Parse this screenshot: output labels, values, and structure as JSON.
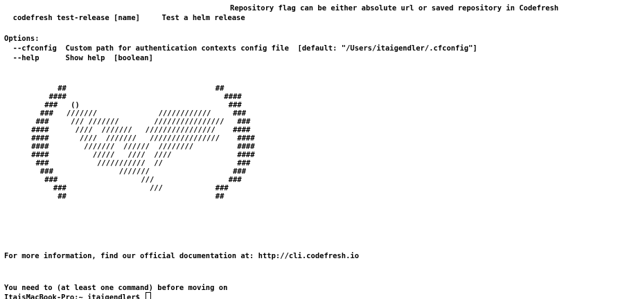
{
  "terminal": {
    "top_line": "Repository flag can be either absolute url or saved repository in Codefresh",
    "command_line": "  codefresh test-release [name]     Test a helm release",
    "options_header": "Options:",
    "option_cfconfig": "  --cfconfig  Custom path for authentication contexts config file  [default: \"/Users/itaigendler/.cfconfig\"]",
    "option_help": "  --help      Show help  [boolean]",
    "logo_ascii": "          ##                                  ##\n        ####                                    ####\n       ###   ()                                  ###\n      ###   ///////              ////////////     ###\n     ###     /// ///////        ////////////////   ###\n    ####      ////  ///////   ////////////////    ####\n    ####       ////  ///////   ////////////////    ####\n    ####        ///////  //////  ////////          ####\n    ####          /////   ////  ////               ####\n     ###           ///////////  //                 ###\n      ###               ///////                   ###\n       ###                   ///                 ###\n         ###                   ///            ###\n          ##                                  ##",
    "info_line": "For more information, find our official documentation at: http://cli.codefresh.io",
    "prompt_line1": "You need to (at least one command) before moving on",
    "prompt_line2": "ItaisMacBook-Pro:~ itaigendler$ "
  }
}
